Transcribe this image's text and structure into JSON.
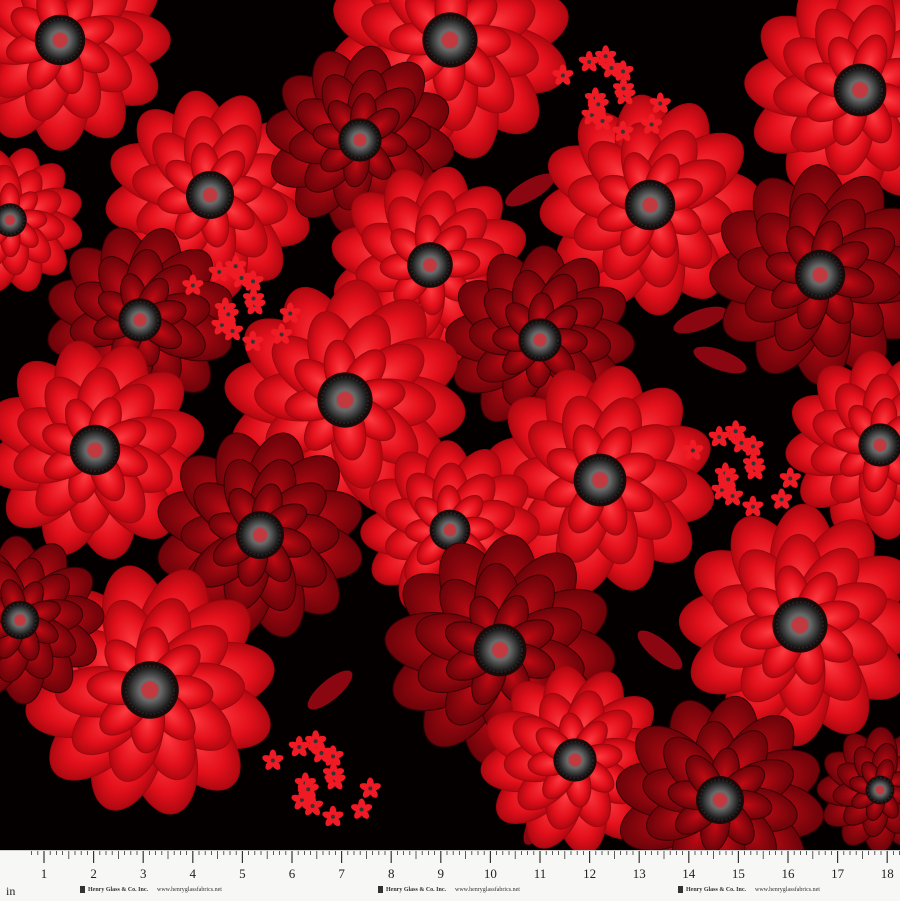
{
  "image": {
    "description_kind": "fabric-swatch",
    "colors": {
      "background": "#050000",
      "petal_light": "#ff1f2a",
      "petal_mid": "#e0101a",
      "petal_dark": "#a0060e",
      "center_gray": "#6f6f6f",
      "selvage": "#f7f7f5"
    }
  },
  "ruler": {
    "unit": "in",
    "numbers": [
      "1",
      "2",
      "3",
      "4",
      "5",
      "6",
      "7",
      "8",
      "9",
      "10",
      "11",
      "12",
      "13",
      "14",
      "15",
      "16",
      "17",
      "18"
    ]
  },
  "selvage_print": [
    {
      "name": "Henry Glass & Co. Inc.",
      "url": "www.henryglassfabrics.net"
    },
    {
      "name": "Henry Glass & Co. Inc.",
      "url": "www.henryglassfabrics.net"
    },
    {
      "name": "Henry Glass & Co. Inc.",
      "url": "www.henryglassfabrics.net"
    }
  ]
}
